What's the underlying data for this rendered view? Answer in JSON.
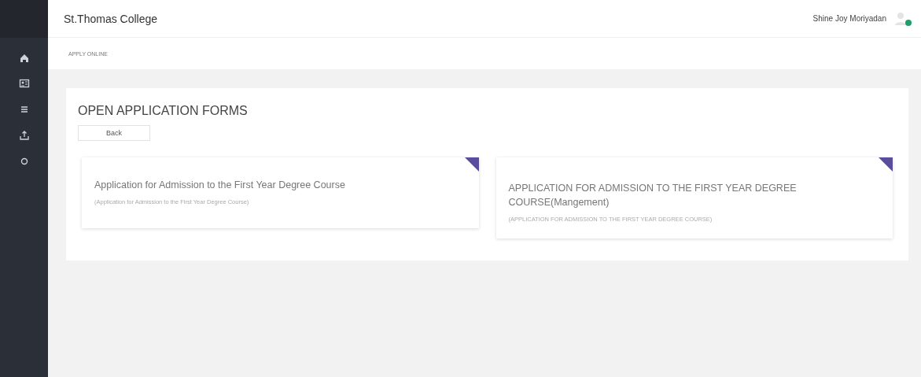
{
  "header": {
    "title": "St.Thomas College",
    "user": {
      "name": "Shine Joy Moriyadan",
      "online": true
    }
  },
  "breadcrumb": "APPLY ONLINE",
  "panel": {
    "title": "OPEN APPLICATION FORMS",
    "back_button": "Back",
    "forms": [
      {
        "title": "Application for Admission to the First Year Degree Course",
        "subtitle": "(Application for Admission to the First Year Degree Course)"
      },
      {
        "title": "APPLICATION FOR ADMISSION TO THE FIRST YEAR DEGREE COURSE(Mangement)",
        "subtitle": "(APPLICATION FOR ADMISSION TO THE FIRST YEAR DEGREE COURSE)"
      }
    ]
  }
}
